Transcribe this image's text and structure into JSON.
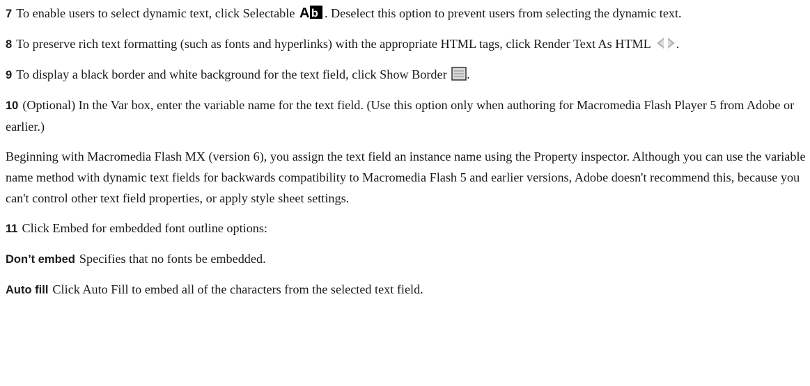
{
  "steps": {
    "s7": {
      "num": "7",
      "text_before": "To enable users to select dynamic text, click Selectable",
      "text_after": ". Deselect this option to prevent users from selecting the dynamic text.",
      "icon": "selectable-icon"
    },
    "s8": {
      "num": "8",
      "text_before": "To preserve rich text formatting (such as fonts and hyperlinks) with the appropriate HTML tags, click Render Text As HTML",
      "text_after": ".",
      "icon": "render-html-icon"
    },
    "s9": {
      "num": "9",
      "text_before": "To display a black border and white background for the text field, click Show Border",
      "text_after": ".",
      "icon": "show-border-icon"
    },
    "s10": {
      "num": "10",
      "text": "(Optional) In the Var box, enter the variable name for the text field. (Use this option only when authoring for Macromedia Flash Player 5 from Adobe or earlier.)"
    },
    "note": "Beginning with Macromedia Flash MX (version 6), you assign the text field an instance name using the Property inspector. Although you can use the variable name method with dynamic text fields for backwards compatibility to Macromedia Flash 5 and earlier versions, Adobe doesn't recommend this, because you can't control other text field properties, or apply style sheet settings.",
    "s11": {
      "num": "11",
      "text": "Click Embed for embedded font outline options:"
    }
  },
  "options": [
    {
      "term": "Don’t embed",
      "desc": "Specifies that no fonts be embedded."
    },
    {
      "term": "Auto fill",
      "desc": "Click Auto Fill to embed all of the characters from the selected text field."
    }
  ]
}
